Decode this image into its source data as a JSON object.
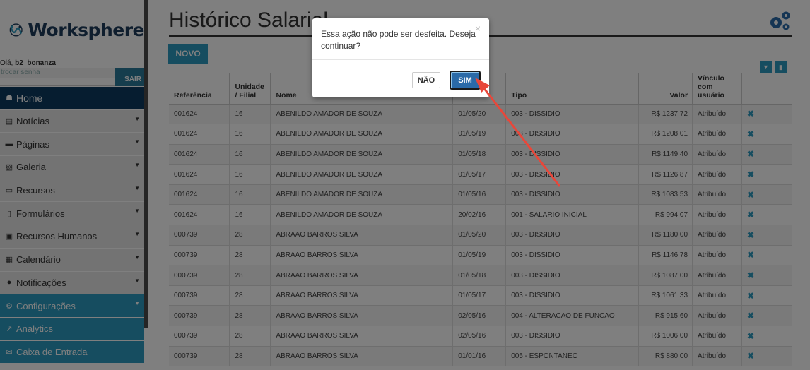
{
  "brand": {
    "name": "Worksphere"
  },
  "user": {
    "greeting_prefix": "Olá,",
    "username": "b2_bonanza",
    "change_password": "trocar senha",
    "logout": "SAIR"
  },
  "menu": [
    {
      "label": "Home",
      "icon": "home-icon",
      "glyph": "☗",
      "style": "home",
      "caret": false
    },
    {
      "label": "Notícias",
      "icon": "newspaper-icon",
      "glyph": "▤",
      "style": "dark",
      "caret": true
    },
    {
      "label": "Páginas",
      "icon": "window-icon",
      "glyph": "▬",
      "style": "dark",
      "caret": true
    },
    {
      "label": "Galeria",
      "icon": "image-icon",
      "glyph": "▧",
      "style": "dark",
      "caret": true
    },
    {
      "label": "Recursos",
      "icon": "laptop-icon",
      "glyph": "▭",
      "style": "dark",
      "caret": true
    },
    {
      "label": "Formulários",
      "icon": "file-icon",
      "glyph": "▯",
      "style": "dark",
      "caret": true
    },
    {
      "label": "Recursos Humanos",
      "icon": "badge-icon",
      "glyph": "▣",
      "style": "dark",
      "caret": true
    },
    {
      "label": "Calendário",
      "icon": "calendar-icon",
      "glyph": "▦",
      "style": "dark",
      "caret": true
    },
    {
      "label": "Notificações",
      "icon": "info-icon",
      "glyph": "●",
      "style": "dark",
      "caret": true
    },
    {
      "label": "Configurações",
      "icon": "gear-icon",
      "glyph": "⚙",
      "style": "blue",
      "caret": true
    },
    {
      "label": "Analytics",
      "icon": "chart-icon",
      "glyph": "↗",
      "style": "blue",
      "caret": false
    },
    {
      "label": "Caixa de Entrada",
      "icon": "envelope-icon",
      "glyph": "✉",
      "style": "blue",
      "caret": false
    }
  ],
  "page": {
    "title": "Histórico Salarial",
    "new_button": "NOVO"
  },
  "table": {
    "headers": [
      "Referência",
      "Unidade / Filial",
      "Nome",
      "Data",
      "Tipo",
      "Valor",
      "Vínculo com usuário",
      ""
    ],
    "rows": [
      [
        "001624",
        "16",
        "ABENILDO AMADOR DE SOUZA",
        "01/05/20",
        "003 - DISSIDIO",
        "R$ 1237.72",
        "Atribuído"
      ],
      [
        "001624",
        "16",
        "ABENILDO AMADOR DE SOUZA",
        "01/05/19",
        "003 - DISSIDIO",
        "R$ 1208.01",
        "Atribuído"
      ],
      [
        "001624",
        "16",
        "ABENILDO AMADOR DE SOUZA",
        "01/05/18",
        "003 - DISSIDIO",
        "R$ 1149.40",
        "Atribuído"
      ],
      [
        "001624",
        "16",
        "ABENILDO AMADOR DE SOUZA",
        "01/05/17",
        "003 - DISSIDIO",
        "R$ 1126.87",
        "Atribuído"
      ],
      [
        "001624",
        "16",
        "ABENILDO AMADOR DE SOUZA",
        "01/05/16",
        "003 - DISSIDIO",
        "R$ 1083.53",
        "Atribuído"
      ],
      [
        "001624",
        "16",
        "ABENILDO AMADOR DE SOUZA",
        "20/02/16",
        "001 - SALARIO INICIAL",
        "R$ 994.07",
        "Atribuído"
      ],
      [
        "000739",
        "28",
        "ABRAAO BARROS SILVA",
        "01/05/20",
        "003 - DISSIDIO",
        "R$ 1180.00",
        "Atribuído"
      ],
      [
        "000739",
        "28",
        "ABRAAO BARROS SILVA",
        "01/05/19",
        "003 - DISSIDIO",
        "R$ 1146.78",
        "Atribuído"
      ],
      [
        "000739",
        "28",
        "ABRAAO BARROS SILVA",
        "01/05/18",
        "003 - DISSIDIO",
        "R$ 1087.00",
        "Atribuído"
      ],
      [
        "000739",
        "28",
        "ABRAAO BARROS SILVA",
        "01/05/17",
        "003 - DISSIDIO",
        "R$ 1061.33",
        "Atribuído"
      ],
      [
        "000739",
        "28",
        "ABRAAO BARROS SILVA",
        "02/05/16",
        "004 - ALTERACAO DE FUNCAO",
        "R$ 915.60",
        "Atribuído"
      ],
      [
        "000739",
        "28",
        "ABRAAO BARROS SILVA",
        "02/05/16",
        "003 - DISSIDIO",
        "R$ 1006.00",
        "Atribuído"
      ],
      [
        "000739",
        "28",
        "ABRAAO BARROS SILVA",
        "01/01/16",
        "005 - ESPONTANEO",
        "R$ 880.00",
        "Atribuído"
      ]
    ],
    "delete_glyph": "✖"
  },
  "dialog": {
    "message": "Essa ação não pode ser desfeita. Deseja continuar?",
    "close": "×",
    "no_label": "NÃO",
    "yes_label": "SIM"
  },
  "colors": {
    "accent": "#2d9ac0",
    "home": "#0d3b61",
    "annotation_arrow": "#e8473a"
  }
}
